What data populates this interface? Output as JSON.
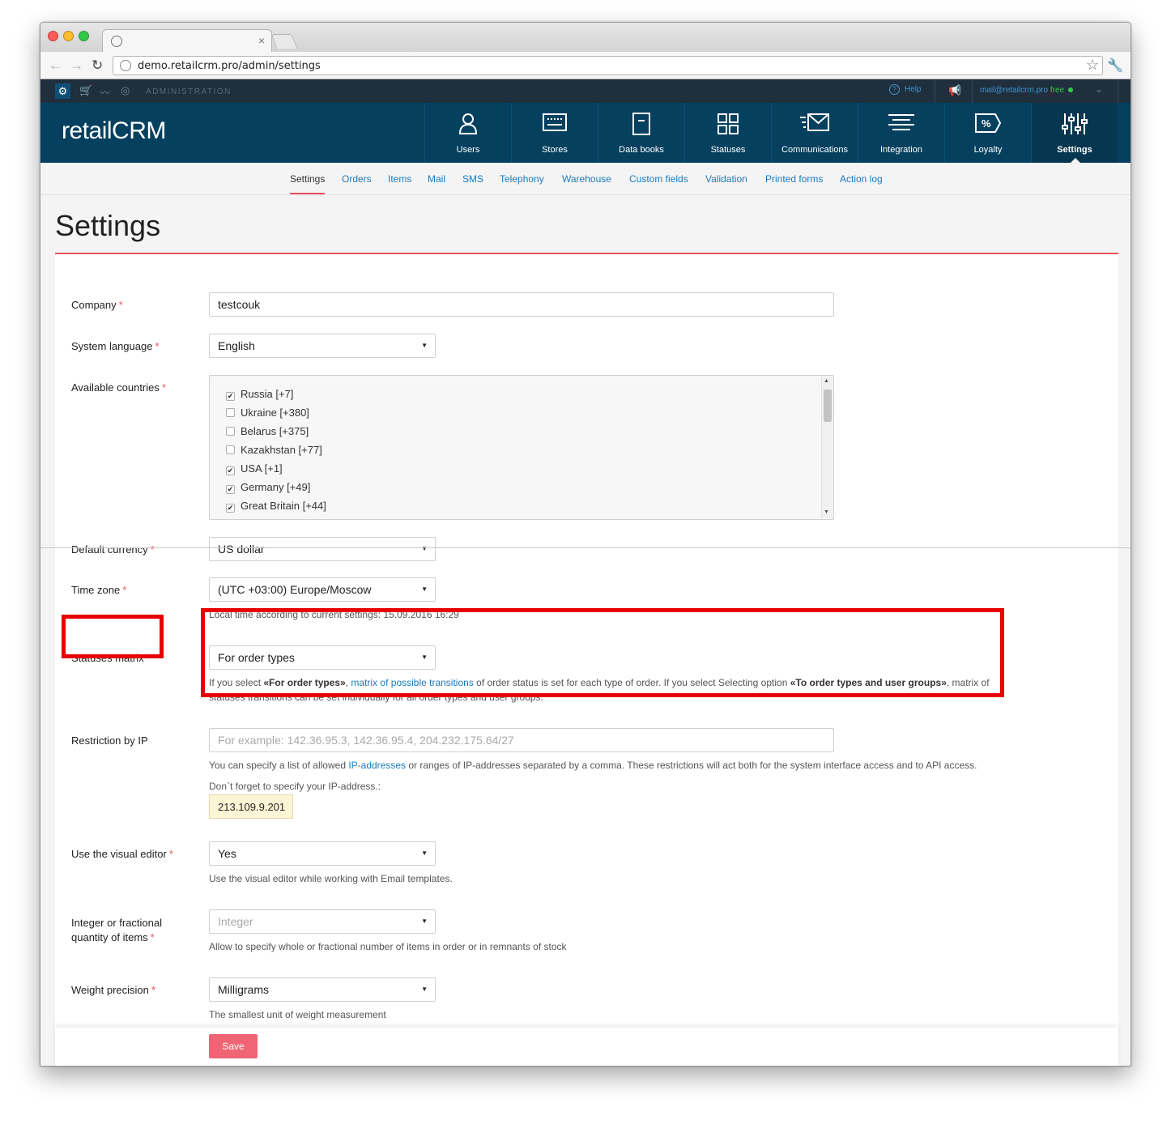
{
  "browser": {
    "url": "demo.retailcrm.pro/admin/settings"
  },
  "admin_bar": {
    "label": "ADMINISTRATION",
    "help": "Help",
    "user_email": "mail@retailcrm.pro",
    "plan": "free"
  },
  "brand": {
    "logo_text": "retailCRM"
  },
  "main_nav": [
    {
      "label": "Users",
      "icon": "user-icon"
    },
    {
      "label": "Stores",
      "icon": "store-icon"
    },
    {
      "label": "Data books",
      "icon": "book-icon"
    },
    {
      "label": "Statuses",
      "icon": "statuses-icon"
    },
    {
      "label": "Communications",
      "icon": "mail-icon"
    },
    {
      "label": "Integration",
      "icon": "integration-icon"
    },
    {
      "label": "Loyalty",
      "icon": "percent-icon"
    },
    {
      "label": "Settings",
      "icon": "sliders-icon",
      "active": true
    }
  ],
  "sub_nav": [
    "Settings",
    "Orders",
    "Items",
    "Mail",
    "SMS",
    "Telephony",
    "Warehouse",
    "Custom fields",
    "Validation",
    "Printed forms",
    "Action log"
  ],
  "page": {
    "title": "Settings"
  },
  "form": {
    "company": {
      "label": "Company",
      "value": "testcouk"
    },
    "system_language": {
      "label": "System language",
      "value": "English"
    },
    "available_countries": {
      "label": "Available countries",
      "options": [
        {
          "name": "Russia [+7]",
          "checked": true
        },
        {
          "name": "Ukraine [+380]",
          "checked": false
        },
        {
          "name": "Belarus [+375]",
          "checked": false
        },
        {
          "name": "Kazakhstan [+77]",
          "checked": false
        },
        {
          "name": "USA [+1]",
          "checked": true
        },
        {
          "name": "Germany [+49]",
          "checked": true
        },
        {
          "name": "Great Britain [+44]",
          "checked": true
        }
      ]
    },
    "default_currency": {
      "label": "Default currency",
      "value": "US dollar"
    },
    "time_zone": {
      "label": "Time zone",
      "value": "(UTC +03:00) Europe/Moscow",
      "hint": "Local time according to current settings: 15.09.2016 16:29"
    },
    "statuses_matrix": {
      "label": "Statuses matrix",
      "value": "For order types",
      "hint_1": "If you select ",
      "hint_2": "«For order types»",
      "hint_3": ", ",
      "hint_link": "matrix of possible transitions",
      "hint_4": " of order status is set for each type of order. If you select Selecting option ",
      "hint_5": "«To order types and user groups»",
      "hint_6": ", matrix of statuses transitions can be set individually for all order types and user groups."
    },
    "restriction_ip": {
      "label": "Restriction by IP",
      "placeholder": "For example: 142.36.95.3, 142.36.95.4, 204.232.175.64/27",
      "hint_1": "You can specify a list of allowed ",
      "hint_link": "IP-addresses",
      "hint_2": " or ranges of IP-addresses separated by a comma. These restrictions will act both for the system interface access and to API access.",
      "reminder": "Don`t forget to specify your IP-address.:",
      "current_ip": "213.109.9.201"
    },
    "visual_editor": {
      "label": "Use the visual editor",
      "value": "Yes",
      "hint": "Use the visual editor while working with Email templates."
    },
    "quantity_type": {
      "label_1": "Integer or fractional",
      "label_2": "quantity of items",
      "value": "Integer",
      "hint": "Allow to specify whole or fractional number of items in order or in remnants of stock"
    },
    "weight_precision": {
      "label": "Weight precision",
      "value": "Milligrams",
      "hint": "The smallest unit of weight measurement"
    },
    "required_mark": "*",
    "save_label": "Save"
  },
  "colors": {
    "nav_bg": "#05405f",
    "admin_bar_bg": "#1f2f3e",
    "accent_red": "#e8525f",
    "link_blue": "#1a7bbf",
    "highlight": "#e60000"
  }
}
